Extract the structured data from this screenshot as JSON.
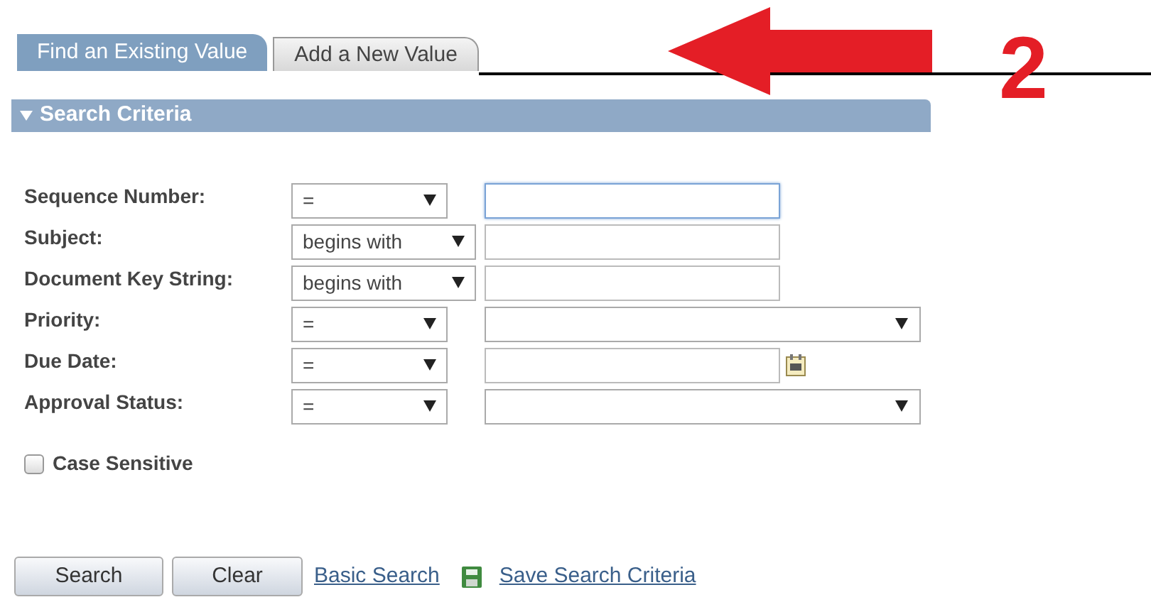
{
  "tabs": [
    {
      "label": "Find an Existing Value",
      "selected": true
    },
    {
      "label": "Add a New Value",
      "selected": false
    }
  ],
  "section": {
    "title": "Search Criteria",
    "expanded": true
  },
  "fields": [
    {
      "label": "Sequence Number:",
      "operator": "=",
      "kind": "text",
      "focused": true
    },
    {
      "label": "Subject:",
      "operator": "begins with",
      "kind": "text",
      "focused": false
    },
    {
      "label": "Document Key String:",
      "operator": "begins with",
      "kind": "text",
      "focused": false
    },
    {
      "label": "Priority:",
      "operator": "=",
      "kind": "select"
    },
    {
      "label": "Due Date:",
      "operator": "=",
      "kind": "date",
      "focused": false
    },
    {
      "label": "Approval Status:",
      "operator": "=",
      "kind": "select"
    }
  ],
  "case_sensitive": {
    "label": "Case Sensitive",
    "checked": false
  },
  "buttons": [
    "Search",
    "Clear"
  ],
  "links": [
    {
      "label": "Basic Search",
      "kind": "link"
    },
    {
      "label": "Save Search Criteria",
      "kind": "save"
    }
  ],
  "annotation": {
    "number": "2"
  }
}
